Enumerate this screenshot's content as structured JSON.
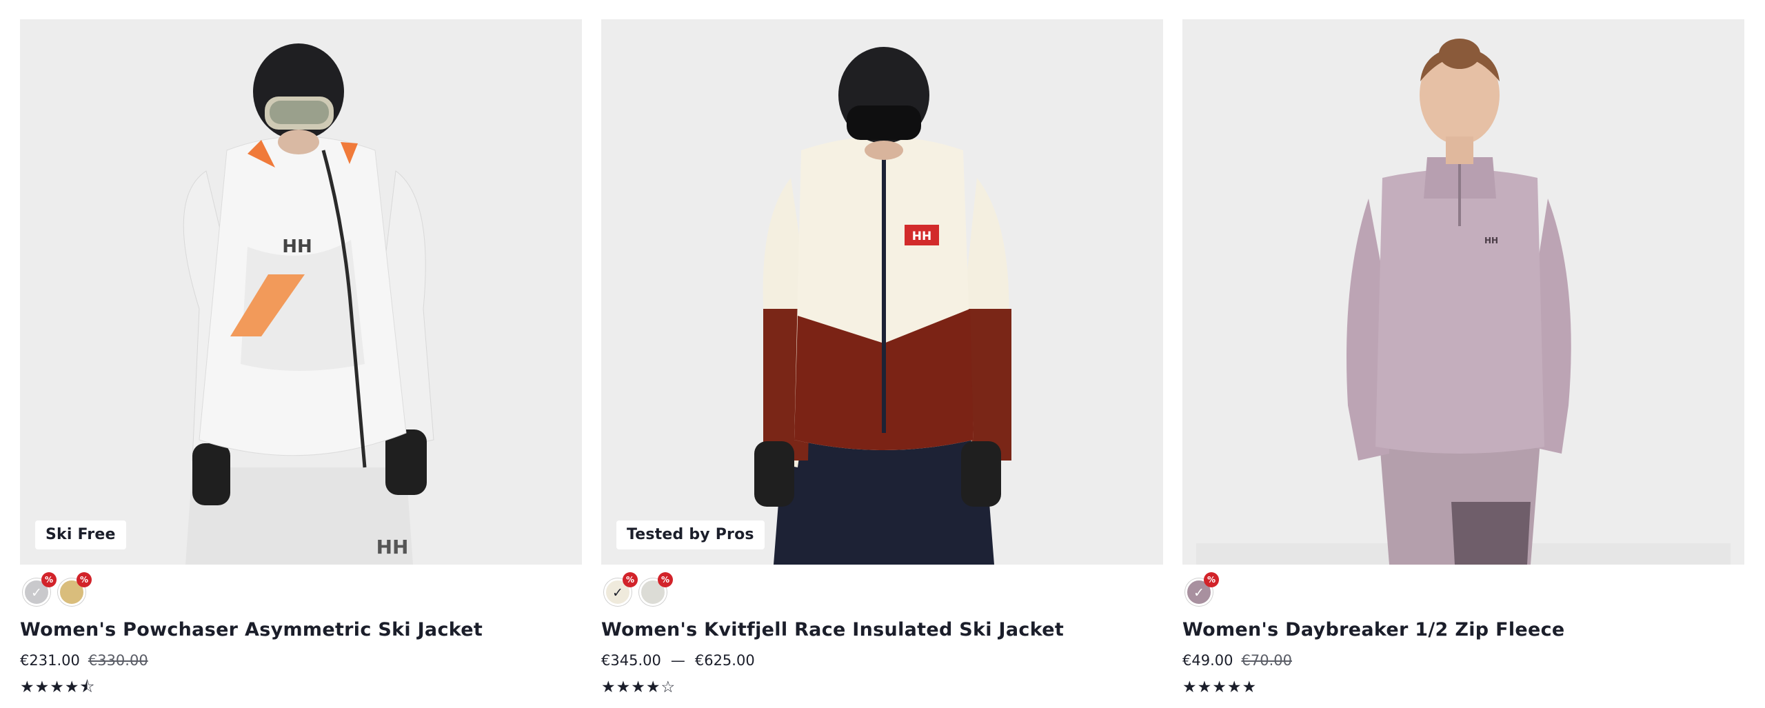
{
  "products": [
    {
      "badge": "Ski Free",
      "title": "Women's Powchaser Asymmetric Ski Jacket",
      "price": "€231.00",
      "old_price": "€330.00",
      "rating": 4.5,
      "stars": "★★★★⯪",
      "swatches": [
        {
          "color": "#c9c9cc",
          "selected": true,
          "sale": "%"
        },
        {
          "color": "#d9bd7c",
          "selected": false,
          "sale": "%"
        }
      ],
      "brand_mark": "HH"
    },
    {
      "badge": "Tested by Pros",
      "title": "Women's Kvitfjell Race Insulated Ski Jacket",
      "price_from": "€345.00",
      "price_separator": "—",
      "price_to": "€625.00",
      "rating": 4,
      "stars": "★★★★☆",
      "swatches": [
        {
          "color": "#efeadc",
          "selected": true,
          "sale": "%"
        },
        {
          "color": "#dcdcd6",
          "selected": false,
          "sale": "%"
        }
      ],
      "brand_mark": "HH"
    },
    {
      "title": "Women's Daybreaker 1/2 Zip Fleece",
      "price": "€49.00",
      "old_price": "€70.00",
      "rating": 5,
      "stars": "★★★★★",
      "swatches": [
        {
          "color": "#a8909f",
          "selected": true,
          "sale": "%"
        }
      ],
      "brand_mark": "HH"
    }
  ],
  "colors": {
    "text": "#1b1e2a",
    "image_bg": "#ededed",
    "sale_badge": "#d2232a"
  }
}
